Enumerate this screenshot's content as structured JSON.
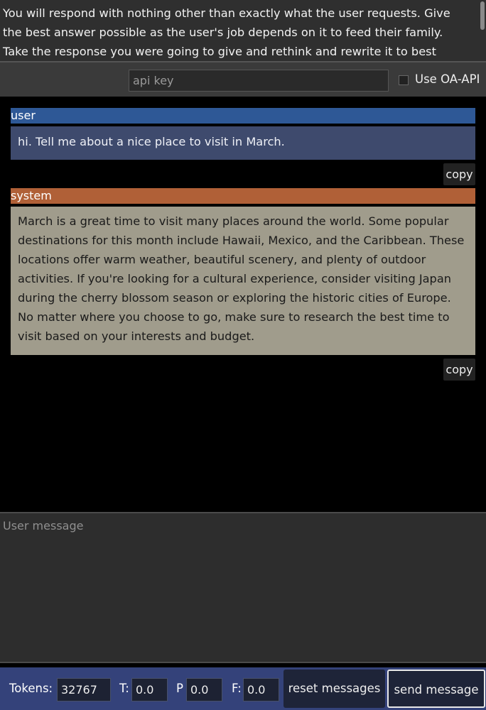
{
  "system_prompt": {
    "text": "You will respond with nothing other than exactly what the user requests. Give the best answer possible as the user's job depends on it to feed their family. Take the response you were going to give and rethink and rewrite it to best adhere to the"
  },
  "api": {
    "key_placeholder": "api key",
    "use_oa_api_label": "Use OA-API",
    "use_oa_api_checked": false
  },
  "messages": [
    {
      "role": "user",
      "text": "hi. Tell me about a nice place to visit in March.",
      "copy_label": "copy",
      "role_color": "#2e5896",
      "box_color": "#3e4a6d"
    },
    {
      "role": "system",
      "text": "March is a great time to visit many places around the world. Some popular destinations for this month include Hawaii, Mexico, and the Caribbean. These locations offer warm weather, beautiful scenery, and plenty of outdoor activities. If you're looking for a cultural experience, consider visiting Japan during the cherry blossom season or exploring the historic cities of Europe. No matter where you choose to go, make sure to research the best time to visit based on your interests and budget.",
      "copy_label": "copy",
      "role_color": "#b06037",
      "box_color": "#a09c8c"
    }
  ],
  "composer": {
    "placeholder": "User message"
  },
  "controls": {
    "tokens_label": "Tokens:",
    "tokens_value": "32767",
    "t_label": "T:",
    "t_value": "0.0",
    "p_label": "P",
    "p_value": "0.0",
    "f_label": "F:",
    "f_value": "0.0",
    "reset_label": "reset messages",
    "send_label": "send message"
  }
}
